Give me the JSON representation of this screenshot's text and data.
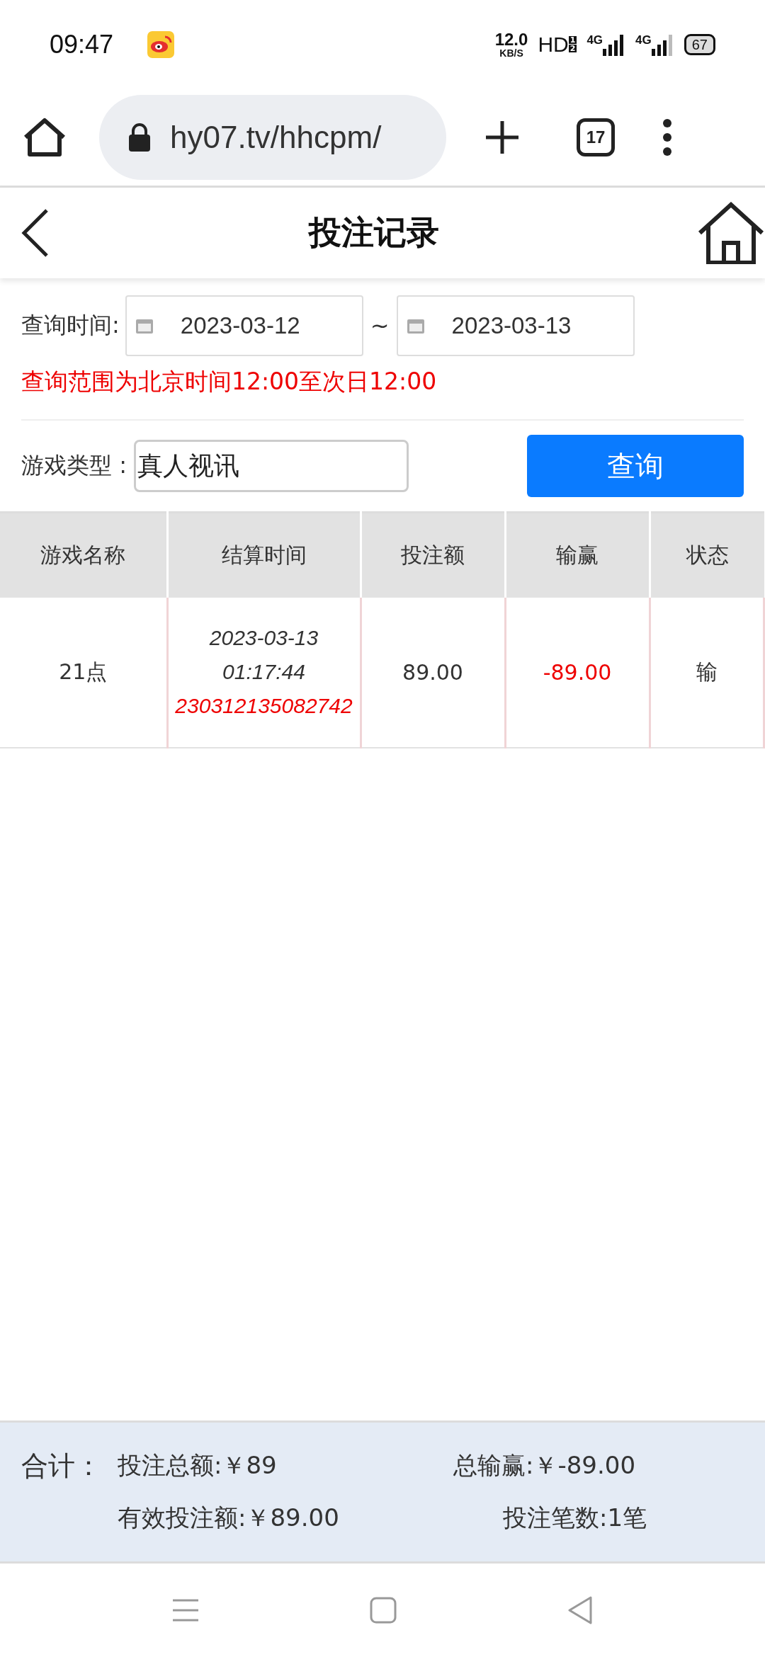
{
  "status_bar": {
    "time": "09:47",
    "net_speed": "12.0",
    "net_unit": "KB/S",
    "hd": "HD",
    "hd_slots": [
      "1",
      "2"
    ],
    "sim_1": "4G",
    "sim_2": "4G",
    "battery": "67"
  },
  "browser": {
    "url": "hy07.tv/hhcpm/",
    "tab_count": "17"
  },
  "header": {
    "title": "投注记录"
  },
  "filter": {
    "date_label": "查询时间:",
    "date_from": "2023-03-12",
    "separator": "~",
    "date_to": "2023-03-13",
    "note": "查询范围为北京时间12:00至次日12:00",
    "game_type_label": "游戏类型 :",
    "game_type": "真人视讯",
    "search_button": "查询"
  },
  "table": {
    "columns": [
      "游戏名称",
      "结算时间",
      "投注额",
      "输赢",
      "状态"
    ],
    "rows": [
      {
        "game": "21点",
        "settle_date": "2023-03-13",
        "settle_time": "01:17:44",
        "order_no": "230312135082742",
        "bet": "89.00",
        "win_loss": "-89.00",
        "status": "输"
      }
    ]
  },
  "summary": {
    "label": "合计：",
    "total_bet": "投注总额:￥89",
    "total_win_loss": "总输赢:￥-89.00",
    "valid_bet": "有效投注额:￥89.00",
    "bet_count": "投注笔数:1笔"
  }
}
